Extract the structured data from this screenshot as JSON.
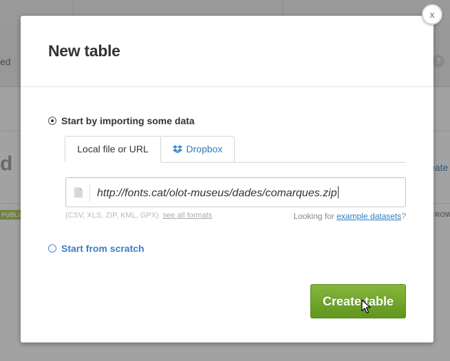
{
  "background": {
    "fragment_ed": "ed",
    "fragment_help": "?",
    "fragment_d": "d",
    "fragment_eate": "eate",
    "fragment_publ": "PUBLI",
    "fragment_row": "ROW"
  },
  "modal": {
    "title": "New table",
    "close_label": "x",
    "import_option": {
      "label": "Start by importing some data",
      "selected": true
    },
    "tabs": [
      {
        "label": "Local file or URL",
        "active": true
      },
      {
        "label": "Dropbox",
        "active": false,
        "icon": "dropbox-icon"
      }
    ],
    "url_input": {
      "value": "http://fonts.cat/olot-museus/dades/comarques.zip"
    },
    "formats_text": "(CSV, XLS, ZIP, KML, GPX)",
    "see_all_label": "see all formats",
    "looking_for": "Looking for",
    "example_link": "example datasets",
    "question_mark": "?",
    "scratch_option": {
      "label": "Start from scratch",
      "selected": false
    },
    "create_button": "Create table"
  },
  "colors": {
    "accent_blue": "#2f7cc0",
    "button_green": "#6fa52b",
    "title_text": "#333333"
  }
}
